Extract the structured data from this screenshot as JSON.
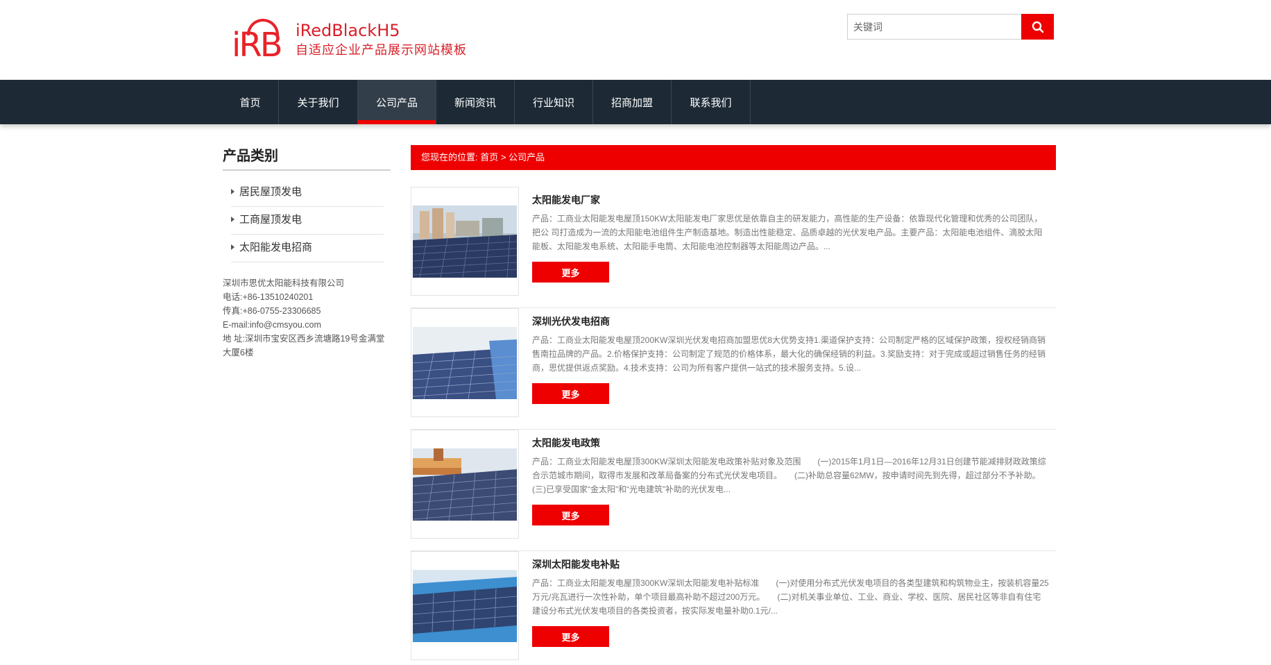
{
  "brand": {
    "logo_mark": "iRB",
    "title": "iRedBlackH5",
    "subtitle": "自适应企业产品展示网站模板"
  },
  "search": {
    "placeholder": "关键词"
  },
  "nav": {
    "items": [
      {
        "label": "首页",
        "width": 82
      },
      {
        "label": "关于我们",
        "width": 114
      },
      {
        "label": "公司产品",
        "width": 113
      },
      {
        "label": "新闻资讯",
        "width": 113
      },
      {
        "label": "行业知识",
        "width": 113
      },
      {
        "label": "招商加盟",
        "width": 113
      },
      {
        "label": "联系我们",
        "width": 114
      }
    ],
    "active_index": 2
  },
  "sidebar": {
    "title": "产品类别",
    "items": [
      {
        "label": "居民屋顶发电"
      },
      {
        "label": "工商屋顶发电"
      },
      {
        "label": "太阳能发电招商"
      }
    ],
    "contact": {
      "company": "深圳市思优太阳能科技有限公司",
      "phone": "电话:+86-13510240201",
      "fax": "传真:+86-0755-23306685",
      "email": "E-mail:info@cmsyou.com",
      "address": "地 址:深圳市宝安区西乡流塘路19号金满堂大厦6楼"
    }
  },
  "breadcrumb": {
    "prefix": "您现在的位置:",
    "home": "首页",
    "separator": ">",
    "current": "公司产品"
  },
  "products": [
    {
      "title": "太阳能发电厂家",
      "desc": "产品：工商业太阳能发电屋顶150KW太阳能发电厂家思优是依靠自主的研发能力，高性能的生产设备：依靠现代化管理和优秀的公司团队，把公 司打造成为一流的太阳能电池组件生产制造基地。制造出性能稳定、品质卓越的光伏发电产品。主要产品：太阳能电池组件、滴胶太阳能板、太阳能发电系统、太阳能手电筒、太阳能电池控制器等太阳能周边产品。...",
      "more": "更多"
    },
    {
      "title": "深圳光伏发电招商",
      "desc": "产品：工商业太阳能发电屋顶200KW深圳光伏发电招商加盟思优8大优势支持1.渠道保护支持：公司制定严格的区域保护政策，授权经销商销售南拉品牌的产品。2.价格保护支持：公司制定了规范的价格体系，最大化的确保经销的利益。3.奖励支持：对于完成或超过销售任务的经销商，思优提供返点奖励。4.技术支持：公司为所有客户提供一站式的技术服务支持。5.设...",
      "more": "更多"
    },
    {
      "title": "太阳能发电政策",
      "desc": "产品：工商业太阳能发电屋顶300KW深圳太阳能发电政策补贴对象及范围　　(一)2015年1月1日—2016年12月31日创建节能减排财政政策综合示范城市期间，取得市发展和改革局备案的分布式光伏发电项目。　　(二)补助总容量62MW，按申请时间先到先得，超过部分不予补助。(三)已享受国家“金太阳”和“光电建筑”补助的光伏发电...",
      "more": "更多"
    },
    {
      "title": "深圳太阳能发电补贴",
      "desc": "产品：工商业太阳能发电屋顶300KW深圳太阳能发电补贴标准　　(一)对使用分布式光伏发电项目的各类型建筑和构筑物业主，按装机容量25万元/兆瓦进行一次性补助，单个项目最高补助不超过200万元。　　(二)对机关事业单位、工业、商业、学校、医院、居民社区等非自有住宅建设分布式光伏发电项目的各类投资者，按实际发电量补助0.1元/...",
      "more": "更多"
    }
  ],
  "colors": {
    "accent": "#ee0000",
    "nav_bg": "#1d2a36",
    "brand_red": "#e8232a"
  }
}
